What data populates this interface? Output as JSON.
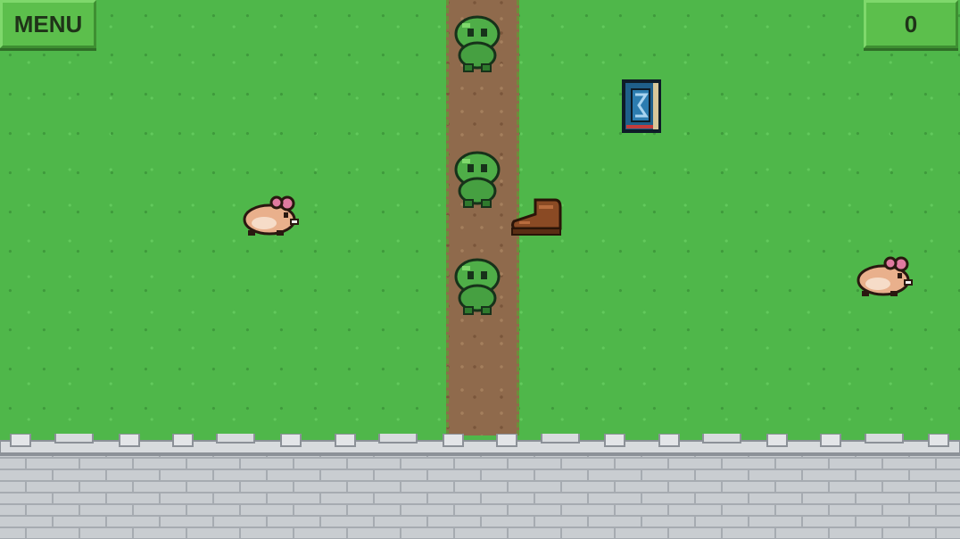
{
  "hud": {
    "menu_label": "MENU",
    "score": "0"
  },
  "colors": {
    "grass": "#4fb74a",
    "dirt": "#8f6a4c",
    "button": "#5cbf4c",
    "wall": "#c9cdd1",
    "slime": "#4fae48",
    "hamster": "#e9b08c",
    "spellbook": "#1f5f8a",
    "boot": "#8a4a24"
  },
  "sprites": {
    "enemies": [
      "green-slime",
      "green-slime",
      "green-slime"
    ],
    "creatures": [
      "pink-hamster",
      "pink-hamster"
    ],
    "items": [
      "blue-spellbook",
      "leather-boot"
    ]
  }
}
